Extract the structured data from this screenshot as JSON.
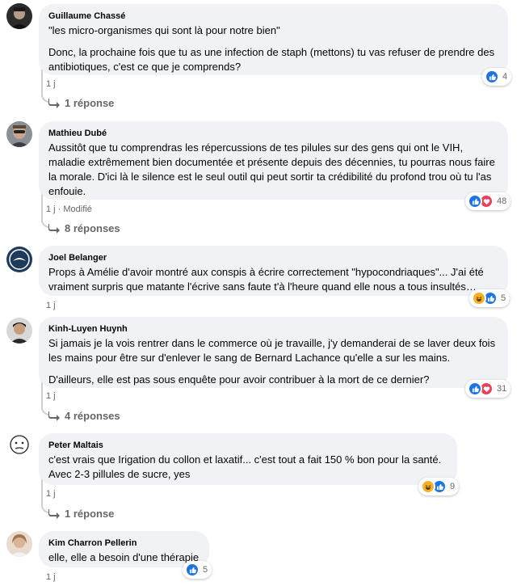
{
  "comments": [
    {
      "author": "Guillaume Chassé",
      "paragraphs": [
        "\"les micro-organismes qui sont là pour notre bien\"",
        "Donc, la prochaine fois que tu as une infection de staph (mettons) tu vas refuser de prendre des antibiotiques, c'est ce que je comprends?"
      ],
      "time": "1 j",
      "reaction_count": "4",
      "reactions": [
        "like-icon"
      ],
      "replies_label": "1 réponse"
    },
    {
      "author": "Mathieu Dubé",
      "paragraphs": [
        "Aussitôt que tu comprendras les répercussions de tes pilules sur des gens qui ont le VIH, maladie extrêmement bien documentée et présente depuis des décennies, tu pourras nous faire la morale. D'ici là le silence est le seul outil qui peut sortir ta crédibilité du profond trou où tu l'as enfouie."
      ],
      "time": "1 j · Modifié",
      "reaction_count": "48",
      "reactions": [
        "like-icon",
        "love-icon"
      ],
      "replies_label": "8 réponses"
    },
    {
      "author": "Joel Belanger",
      "paragraphs": [
        "Props à Amélie d'avoir montré aux conspis à écrire correctement \"hypocondriaques\"... J'ai été vraiment surpris que matante l'écrive sans faute t'à l'heure quand elle nous a tous insultés…"
      ],
      "time": "1 j",
      "reaction_count": "5",
      "reactions": [
        "haha-icon",
        "like-icon"
      ],
      "replies_label": ""
    },
    {
      "author": "Kinh-Luyen Huynh",
      "paragraphs": [
        "Si jamais je la vois rentrer dans le commerce où je travaille, j'y demanderai de se laver deux fois les mains pour être sur d'enlever le sang de Bernard Lachance qu'elle a sur les mains.",
        "D'ailleurs, elle est pas sous enquête pour avoir contribuer à la mort de ce dernier?"
      ],
      "time": "1 j",
      "reaction_count": "31",
      "reactions": [
        "like-icon",
        "love-icon"
      ],
      "replies_label": "4 réponses"
    },
    {
      "author": "Peter Maltais",
      "paragraphs": [
        "c'est vrais que Irigation du collon et laxatif... c'est tout a fait 150 % bon pour la santé. Avec 2-3 pillules de sucre, yes"
      ],
      "time": "1 j",
      "reaction_count": "9",
      "reactions": [
        "haha-icon",
        "like-icon"
      ],
      "replies_label": "1 réponse"
    },
    {
      "author": "Kim Charron Pellerin",
      "paragraphs": [
        "elle, elle a besoin d'une thérapie"
      ],
      "time": "1 j",
      "reaction_count": "5",
      "reactions": [
        "like-icon"
      ],
      "replies_label": ""
    }
  ],
  "colors": {
    "bubble": "#f0f2f5",
    "like": "#1b74e4",
    "love": "#f33e58",
    "haha": "#f7b125",
    "meta": "#65676b"
  }
}
